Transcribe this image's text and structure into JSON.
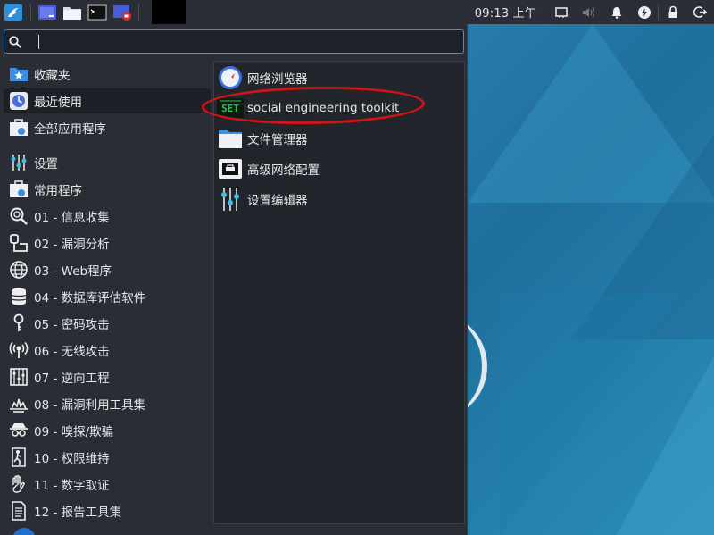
{
  "topbar": {
    "clock": "09:13 上午",
    "launchers": [
      "workspace-icon",
      "file-manager-icon",
      "terminal-icon",
      "screen-recorder-icon"
    ],
    "tray": [
      "window-icon",
      "volume-icon",
      "notification-bell-icon",
      "power-manager-icon",
      "lock-icon",
      "logout-icon"
    ]
  },
  "search": {
    "value": "",
    "placeholder": ""
  },
  "categories": [
    {
      "label": "收藏夹",
      "icon": "favorites-star-icon"
    },
    {
      "label": "最近使用",
      "icon": "recent-clock-icon"
    },
    {
      "label": "全部应用程序",
      "icon": "all-apps-icon"
    },
    {
      "label": "设置",
      "icon": "settings-sliders-icon"
    },
    {
      "label": "常用程序",
      "icon": "common-apps-icon"
    },
    {
      "label": "01 - 信息收集",
      "icon": "magnifier-icon"
    },
    {
      "label": "02 - 漏洞分析",
      "icon": "vuln-analysis-icon"
    },
    {
      "label": "03 - Web程序",
      "icon": "globe-icon"
    },
    {
      "label": "04 - 数据库评估软件",
      "icon": "database-icon"
    },
    {
      "label": "05 - 密码攻击",
      "icon": "key-icon"
    },
    {
      "label": "06 - 无线攻击",
      "icon": "wireless-icon"
    },
    {
      "label": "07 - 逆向工程",
      "icon": "reverse-engineering-icon"
    },
    {
      "label": "08 - 漏洞利用工具集",
      "icon": "exploit-icon"
    },
    {
      "label": "09 - 嗅探/欺骗",
      "icon": "sniffing-icon"
    },
    {
      "label": "10 - 权限维持",
      "icon": "maintain-access-icon"
    },
    {
      "label": "11 - 数字取证",
      "icon": "forensics-hand-icon"
    },
    {
      "label": "12 - 报告工具集",
      "icon": "report-icon"
    }
  ],
  "selected_category": "最近使用",
  "apps": [
    {
      "label": "网络浏览器",
      "icon": "web-browser-icon"
    },
    {
      "label": "social engineering toolkit",
      "icon": "set-toolkit-icon"
    },
    {
      "label": "文件管理器",
      "icon": "folder-icon"
    },
    {
      "label": "高级网络配置",
      "icon": "network-config-icon"
    },
    {
      "label": "设置编辑器",
      "icon": "settings-editor-icon"
    }
  ],
  "colors": {
    "accent": "#3d8fd6",
    "annotation": "#d41414",
    "panel": "#2b2e37",
    "menu": "#2a2d36"
  }
}
